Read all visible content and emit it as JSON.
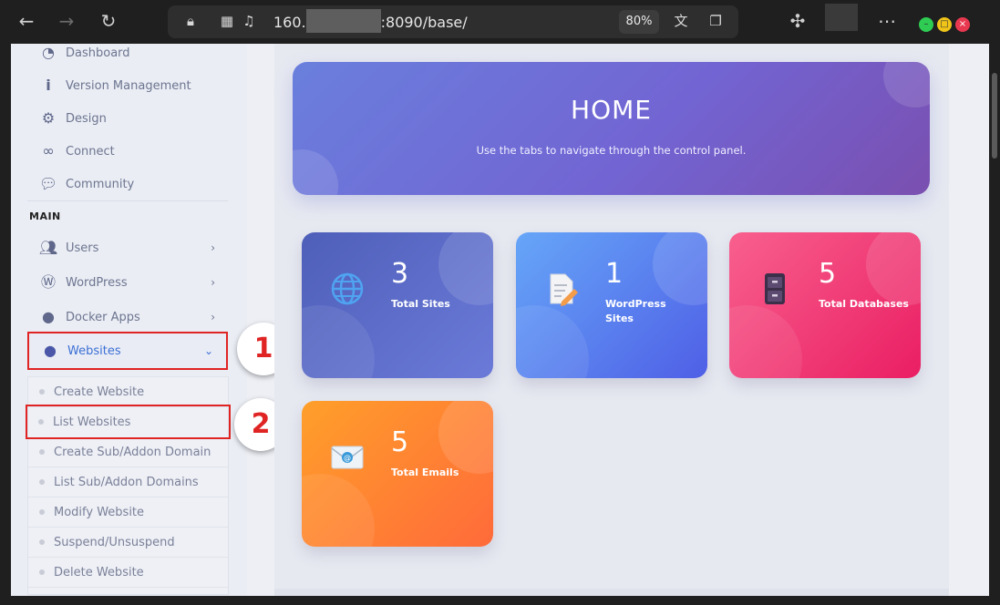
{
  "browser": {
    "url_prefix": "160.",
    "url_suffix": ":8090/base/",
    "zoom": "80%"
  },
  "sidebar": {
    "top_items": [
      {
        "label": "Dashboard",
        "icon": "dashboard-icon"
      },
      {
        "label": "Version Management",
        "icon": "info-icon"
      },
      {
        "label": "Design",
        "icon": "gear-icon"
      },
      {
        "label": "Connect",
        "icon": "link-icon"
      },
      {
        "label": "Community",
        "icon": "chat-icon"
      }
    ],
    "section_title": "MAIN",
    "main_items": [
      {
        "label": "Users",
        "icon": "users-icon"
      },
      {
        "label": "WordPress",
        "icon": "wordpress-icon"
      },
      {
        "label": "Docker Apps",
        "icon": "globe-icon"
      },
      {
        "label": "Websites",
        "icon": "globe-icon"
      }
    ],
    "websites_submenu": [
      "Create Website",
      "List Websites",
      "Create Sub/Addon Domain",
      "List Sub/Addon Domains",
      "Modify Website",
      "Suspend/Unsuspend",
      "Delete Website"
    ]
  },
  "badges": [
    "1",
    "2"
  ],
  "hero": {
    "title": "HOME",
    "subtitle": "Use the tabs to navigate through the control panel."
  },
  "cards": [
    {
      "value": "3",
      "label": "Total Sites",
      "color": "#5b6bc9"
    },
    {
      "value": "1",
      "label": "WordPress Sites",
      "color": "#5a7ff0"
    },
    {
      "value": "5",
      "label": "Total Databases",
      "color": "#f0447a"
    },
    {
      "value": "5",
      "label": "Total Emails",
      "color": "#ff8a2e"
    }
  ]
}
